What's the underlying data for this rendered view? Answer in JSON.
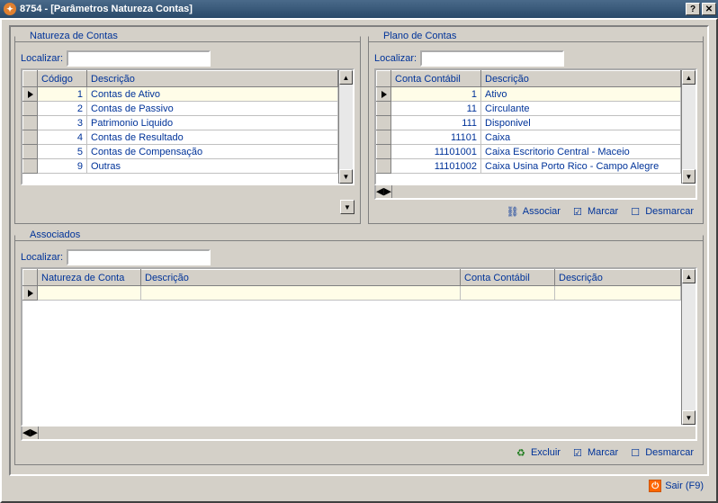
{
  "title": "8754 - [Parâmetros Natureza Contas]",
  "localizar_label": "Localizar:",
  "natureza": {
    "legend": "Natureza de Contas",
    "headers": {
      "codigo": "Código",
      "descricao": "Descrição"
    },
    "rows": [
      {
        "codigo": "1",
        "descricao": "Contas de Ativo",
        "selected": true
      },
      {
        "codigo": "2",
        "descricao": "Contas de Passivo"
      },
      {
        "codigo": "3",
        "descricao": "Patrimonio Liquido"
      },
      {
        "codigo": "4",
        "descricao": "Contas de Resultado"
      },
      {
        "codigo": "5",
        "descricao": "Contas de Compensação"
      },
      {
        "codigo": "9",
        "descricao": "Outras"
      }
    ]
  },
  "plano": {
    "legend": "Plano de Contas",
    "headers": {
      "conta": "Conta Contábil",
      "descricao": "Descrição"
    },
    "rows": [
      {
        "conta": "1",
        "descricao": "Ativo",
        "selected": true
      },
      {
        "conta": "11",
        "descricao": "Circulante"
      },
      {
        "conta": "111",
        "descricao": "Disponivel"
      },
      {
        "conta": "11101",
        "descricao": "Caixa"
      },
      {
        "conta": "11101001",
        "descricao": "Caixa Escritorio Central - Maceio"
      },
      {
        "conta": "11101002",
        "descricao": "Caixa Usina Porto Rico - Campo Alegre"
      }
    ],
    "actions": {
      "associar": "Associar",
      "marcar": "Marcar",
      "desmarcar": "Desmarcar"
    }
  },
  "assoc": {
    "legend": "Associados",
    "headers": {
      "natureza": "Natureza de Conta",
      "descricao1": "Descrição",
      "conta": "Conta Contábil",
      "descricao2": "Descrição"
    },
    "actions": {
      "excluir": "Excluir",
      "marcar": "Marcar",
      "desmarcar": "Desmarcar"
    }
  },
  "sair_label": "Sair (F9)"
}
